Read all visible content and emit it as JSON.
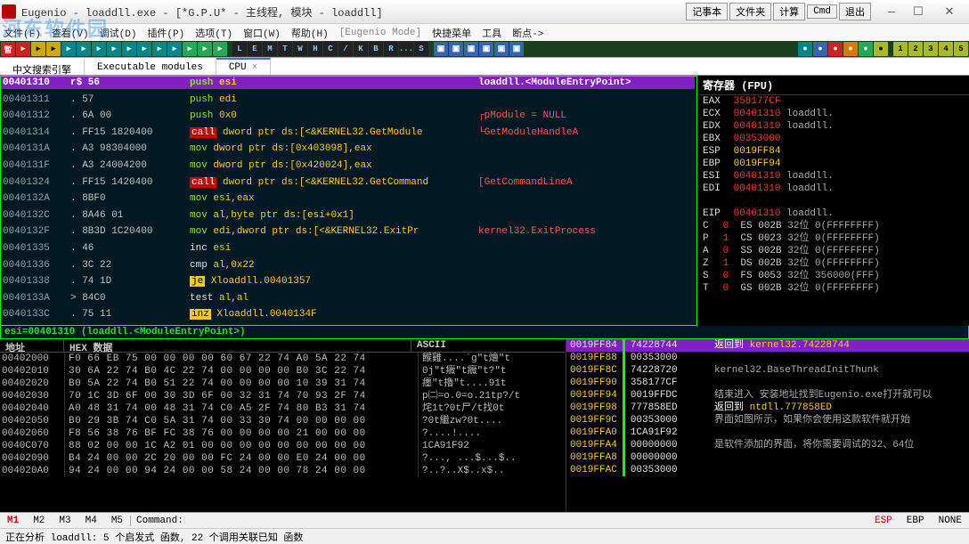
{
  "watermark": "河东软件园",
  "title": "Eugenio - loaddll.exe - [*G.P.U* - 主线程, 模块 - loaddll]",
  "ext_buttons": [
    "记事本",
    "文件夹",
    "计算",
    "Cmd",
    "退出"
  ],
  "menu": [
    "文件(F)",
    "查看(V)",
    "调试(D)",
    "插件(P)",
    "选项(T)",
    "窗口(W)",
    "帮助(H)",
    "[Eugenio Mode]",
    "快捷菜单",
    "工具",
    "断点->"
  ],
  "toolbar_letters": [
    "L",
    "E",
    "M",
    "T",
    "W",
    "H",
    "C",
    "/",
    "K",
    "B",
    "R",
    "...",
    "S"
  ],
  "tabs": [
    {
      "label": "中文搜索引擎",
      "active": false
    },
    {
      "label": "Executable modules",
      "active": false
    },
    {
      "label": "CPU",
      "active": true,
      "closable": true
    }
  ],
  "disasm": {
    "head_addr": "00401310",
    "head_bytes": "r$  56",
    "head_cmt": "loaddll.<ModuleEntryPoint>",
    "rows": [
      {
        "addr": "00401311",
        "bytes": ".  57",
        "mnem_cls": "mnem-push",
        "mnem": "push",
        "args": "edi",
        "cmt": ""
      },
      {
        "addr": "00401312",
        "bytes": ".  6A 00",
        "mnem_cls": "mnem-push",
        "mnem": "push",
        "args": "0x0",
        "cmt": "┌pModule = NULL"
      },
      {
        "addr": "00401314",
        "bytes": ".  FF15 1820400",
        "mnem_cls": "mnem-call",
        "mnem": "call",
        "args": "dword ptr ds:[<&KERNEL32.GetModule",
        "cmt": "└GetModuleHandleA"
      },
      {
        "addr": "0040131A",
        "bytes": ".  A3 98304000",
        "mnem_cls": "mnem-mov",
        "mnem": "mov",
        "args": "dword ptr ds:[0x403098],eax",
        "cmt": ""
      },
      {
        "addr": "0040131F",
        "bytes": ".  A3 24004200",
        "mnem_cls": "mnem-mov",
        "mnem": "mov",
        "args": "dword ptr ds:[0x420024],eax",
        "cmt": ""
      },
      {
        "addr": "00401324",
        "bytes": ".  FF15 1420400",
        "mnem_cls": "mnem-call",
        "mnem": "call",
        "args": "dword ptr ds:[<&KERNEL32.GetCommand",
        "cmt": "[GetCommandLineA"
      },
      {
        "addr": "0040132A",
        "bytes": ".  8BF0",
        "mnem_cls": "mnem-mov",
        "mnem": "mov",
        "args": "esi,eax",
        "cmt": ""
      },
      {
        "addr": "0040132C",
        "bytes": ".  8A46 01",
        "mnem_cls": "mnem-mov",
        "mnem": "mov",
        "args": "al,byte ptr ds:[esi+0x1]",
        "cmt": ""
      },
      {
        "addr": "0040132F",
        "bytes": ".  8B3D 1C20400",
        "mnem_cls": "mnem-mov",
        "mnem": "mov",
        "args": "edi,dword ptr ds:[<&KERNEL32.ExitPr",
        "cmt": "kernel32.ExitProcess"
      },
      {
        "addr": "00401335",
        "bytes": ".  46",
        "mnem_cls": "",
        "mnem": "inc",
        "args": "esi",
        "cmt": ""
      },
      {
        "addr": "00401336",
        "bytes": ".  3C 22",
        "mnem_cls": "",
        "mnem": "cmp",
        "args": "al,0x22",
        "cmt": ""
      },
      {
        "addr": "00401338",
        "bytes": ".  74 1D",
        "mnem_cls": "mnem-je",
        "mnem": "je",
        "args": "Xloaddll.00401357",
        "cmt": ""
      },
      {
        "addr": "0040133A",
        "bytes": ">  84C0",
        "mnem_cls": "",
        "mnem": "test",
        "args": "al,al",
        "cmt": ""
      },
      {
        "addr": "0040133C",
        "bytes": ".  75 11",
        "mnem_cls": "mnem-inz",
        "mnem": "inz",
        "args": "Xloaddll.0040134F",
        "cmt": ""
      }
    ],
    "first": {
      "addr": "00401310",
      "bytes": "r$  56",
      "mnem": "push",
      "args": "esi"
    }
  },
  "registers": {
    "title": "寄存器 (FPU)",
    "rows": [
      {
        "n": "EAX",
        "v": "358177CF",
        "sym": ""
      },
      {
        "n": "ECX",
        "v": "00401310",
        "sym": "loaddll.<ModuleEntryPoint>"
      },
      {
        "n": "EDX",
        "v": "00401310",
        "sym": "loaddll.<ModuleEntryPoint>"
      },
      {
        "n": "EBX",
        "v": "00353000",
        "sym": ""
      },
      {
        "n": "ESP",
        "v": "0019FF84",
        "sym": "",
        "c": "#ffcc00"
      },
      {
        "n": "EBP",
        "v": "0019FF94",
        "sym": "",
        "c": "#ffcc00"
      },
      {
        "n": "ESI",
        "v": "00401310",
        "sym": "loaddll.<ModuleEntryPoint>"
      },
      {
        "n": "EDI",
        "v": "00401310",
        "sym": "loaddll.<ModuleEntryPoint>"
      },
      {
        "n": "",
        "v": "",
        "sym": ""
      },
      {
        "n": "EIP",
        "v": "00401310",
        "sym": "loaddll.<ModuleEntryPoint>"
      }
    ],
    "flags": [
      {
        "n": "C",
        "v": "0",
        "seg": "ES",
        "sv": "002B",
        "extra": "32位 0(FFFFFFFF)"
      },
      {
        "n": "P",
        "v": "1",
        "seg": "CS",
        "sv": "0023",
        "extra": "32位 0(FFFFFFFF)"
      },
      {
        "n": "A",
        "v": "0",
        "seg": "SS",
        "sv": "002B",
        "extra": "32位 0(FFFFFFFF)"
      },
      {
        "n": "Z",
        "v": "1",
        "seg": "DS",
        "sv": "002B",
        "extra": "32位 0(FFFFFFFF)"
      },
      {
        "n": "S",
        "v": "0",
        "seg": "FS",
        "sv": "0053",
        "extra": "32位 356000(FFF)"
      },
      {
        "n": "T",
        "v": "0",
        "seg": "GS",
        "sv": "002B",
        "extra": "32位 0(FFFFFFFF)"
      }
    ]
  },
  "esi_line": "esi=00401310 (loaddll.<ModuleEntryPoint>)",
  "dump": {
    "head": [
      "地址",
      "HEX 数据",
      "ASCII"
    ],
    "rows": [
      {
        "a": "00402000",
        "h": "F0 66 EB 75 00 00 00 00 60 67 22 74 A0 5A 22 74",
        "s": "餱雞....`g\"t燴\"t"
      },
      {
        "a": "00402010",
        "h": "30 6A 22 74 B0 4C 22 74 00 00 00 00 B0 3C 22 74",
        "s": "0j\"t癓\"t癓\"t?\"t"
      },
      {
        "a": "00402020",
        "h": "B0 5A 22 74 B0 51 22 74 00 00 00 00 10 39 31 74",
        "s": "癦\"t擼\"t....91t"
      },
      {
        "a": "00402030",
        "h": "70 1C 3D 6F 00 30 3D 6F 00 32 31 74 70 93 2F 74",
        "s": "p㈡=o.0=o.21tp?/t"
      },
      {
        "a": "00402040",
        "h": "A0 48 31 74 00 48 31 74 C0 A5 2F 74 80 B3 31 74",
        "s": "烢1t?0t⼫/t找0t"
      },
      {
        "a": "00402050",
        "h": "B0 29 3B 74 C0 5A 31 74 00 33 30 74 00 00 00 00",
        "s": "?0t繼zw?0t...."
      },
      {
        "a": "00402060",
        "h": "F8 56 38 76 BF FC 38 76 00 00 00 00 21 00 00 00",
        "s": "?....!...."
      },
      {
        "a": "0040C070",
        "h": "88 02 00 00 1C A2 01 00 00 00 00 00 00 00 00 00",
        "s": "1CA91F92"
      },
      {
        "a": "00402090",
        "h": "B4 24 00 00 2C 20 00 00 FC 24 00 00 E0 24 00 00",
        "s": "?...,  ...$...$.."
      },
      {
        "a": "004020A0",
        "h": "94 24 00 00 94 24 00 00 58 24 00 00 78 24 00 00",
        "s": "?..?..X$..x$.."
      }
    ]
  },
  "stack": [
    {
      "a": "0019FF84",
      "v": "74228744",
      "hi": true
    },
    {
      "a": "0019FF88",
      "v": "00353000"
    },
    {
      "a": "0019FF8C",
      "v": "74228720"
    },
    {
      "a": "0019FF90",
      "v": "358177CF"
    },
    {
      "a": "0019FF94",
      "v": "0019FFDC"
    },
    {
      "a": "0019FF98",
      "v": "777858ED"
    },
    {
      "a": "0019FF9C",
      "v": "00353000"
    },
    {
      "a": "0019FFA0",
      "v": "1CA91F92"
    },
    {
      "a": "0019FFA4",
      "v": "00000000"
    },
    {
      "a": "0019FFA8",
      "v": "00000000"
    },
    {
      "a": "0019FFAC",
      "v": "00353000"
    }
  ],
  "stack_info": [
    {
      "hi": true,
      "ret": true,
      "t": "返回到 kernel32.74228744"
    },
    {
      "t": ""
    },
    {
      "t": "kernel32.BaseThreadInitThunk"
    },
    {
      "t": ""
    },
    {
      "t": "结束进入 安装地址找到Eugenio.exe打开就可以"
    },
    {
      "ret": true,
      "t": "返回到 ntdll.777858ED"
    },
    {
      "t": "界面如图所示，如果你会使用这款软件就开始"
    },
    {
      "t": ""
    },
    {
      "t": "是软件添加的界面，将你需要调试的32、64位"
    },
    {
      "t": ""
    },
    {
      "t": ""
    }
  ],
  "cmdbar": {
    "m": [
      "M1",
      "M2",
      "M3",
      "M4",
      "M5"
    ],
    "label": "Command:",
    "flags": [
      "ESP",
      "EBP",
      "NONE"
    ]
  },
  "status": "正在分析 loaddll: 5 个启发式 函数, 22 个调用关联已知 函数"
}
